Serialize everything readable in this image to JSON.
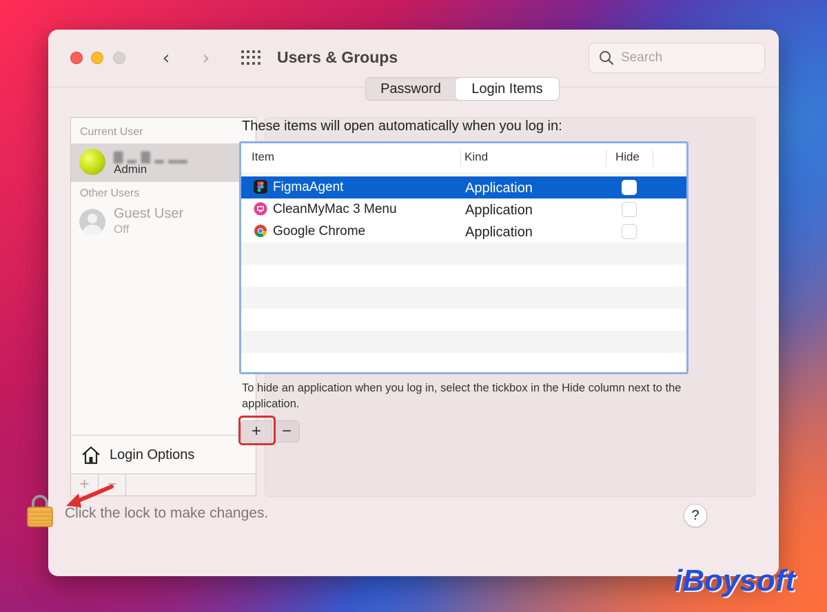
{
  "window": {
    "title": "Users & Groups",
    "search": {
      "placeholder": "Search",
      "value": ""
    }
  },
  "sidebar": {
    "current_user_label": "Current User",
    "current_user": {
      "name": "▇ ▂ ▇ ▂ ▂▂",
      "role": "Admin"
    },
    "other_users_label": "Other Users",
    "guest": {
      "name": "Guest User",
      "status": "Off"
    },
    "login_options": "Login Options",
    "add_label": "+",
    "remove_label": "−"
  },
  "tabs": [
    {
      "label": "Password",
      "selected": false
    },
    {
      "label": "Login Items",
      "selected": true
    }
  ],
  "login_items": {
    "intro": "These items will open automatically when you log in:",
    "columns": [
      "Item",
      "Kind",
      "Hide"
    ],
    "rows": [
      {
        "name": "FigmaAgent",
        "kind": "Application",
        "hide": false,
        "selected": true,
        "icon": "figma-icon"
      },
      {
        "name": "CleanMyMac 3 Menu",
        "kind": "Application",
        "hide": false,
        "selected": false,
        "icon": "cleanmymac-icon"
      },
      {
        "name": "Google Chrome",
        "kind": "Application",
        "hide": false,
        "selected": false,
        "icon": "chrome-icon"
      }
    ],
    "hint": "To hide an application when you log in, select the tickbox in the Hide column next to the application.",
    "add_label": "+",
    "remove_label": "−"
  },
  "footer": {
    "lock_text": "Click the lock to make changes.",
    "help_label": "?"
  },
  "watermark": "iBoysoft",
  "colors": {
    "selection": "#0a62d0",
    "highlight_box": "#d63232",
    "watermark": "#1f4fe0"
  }
}
